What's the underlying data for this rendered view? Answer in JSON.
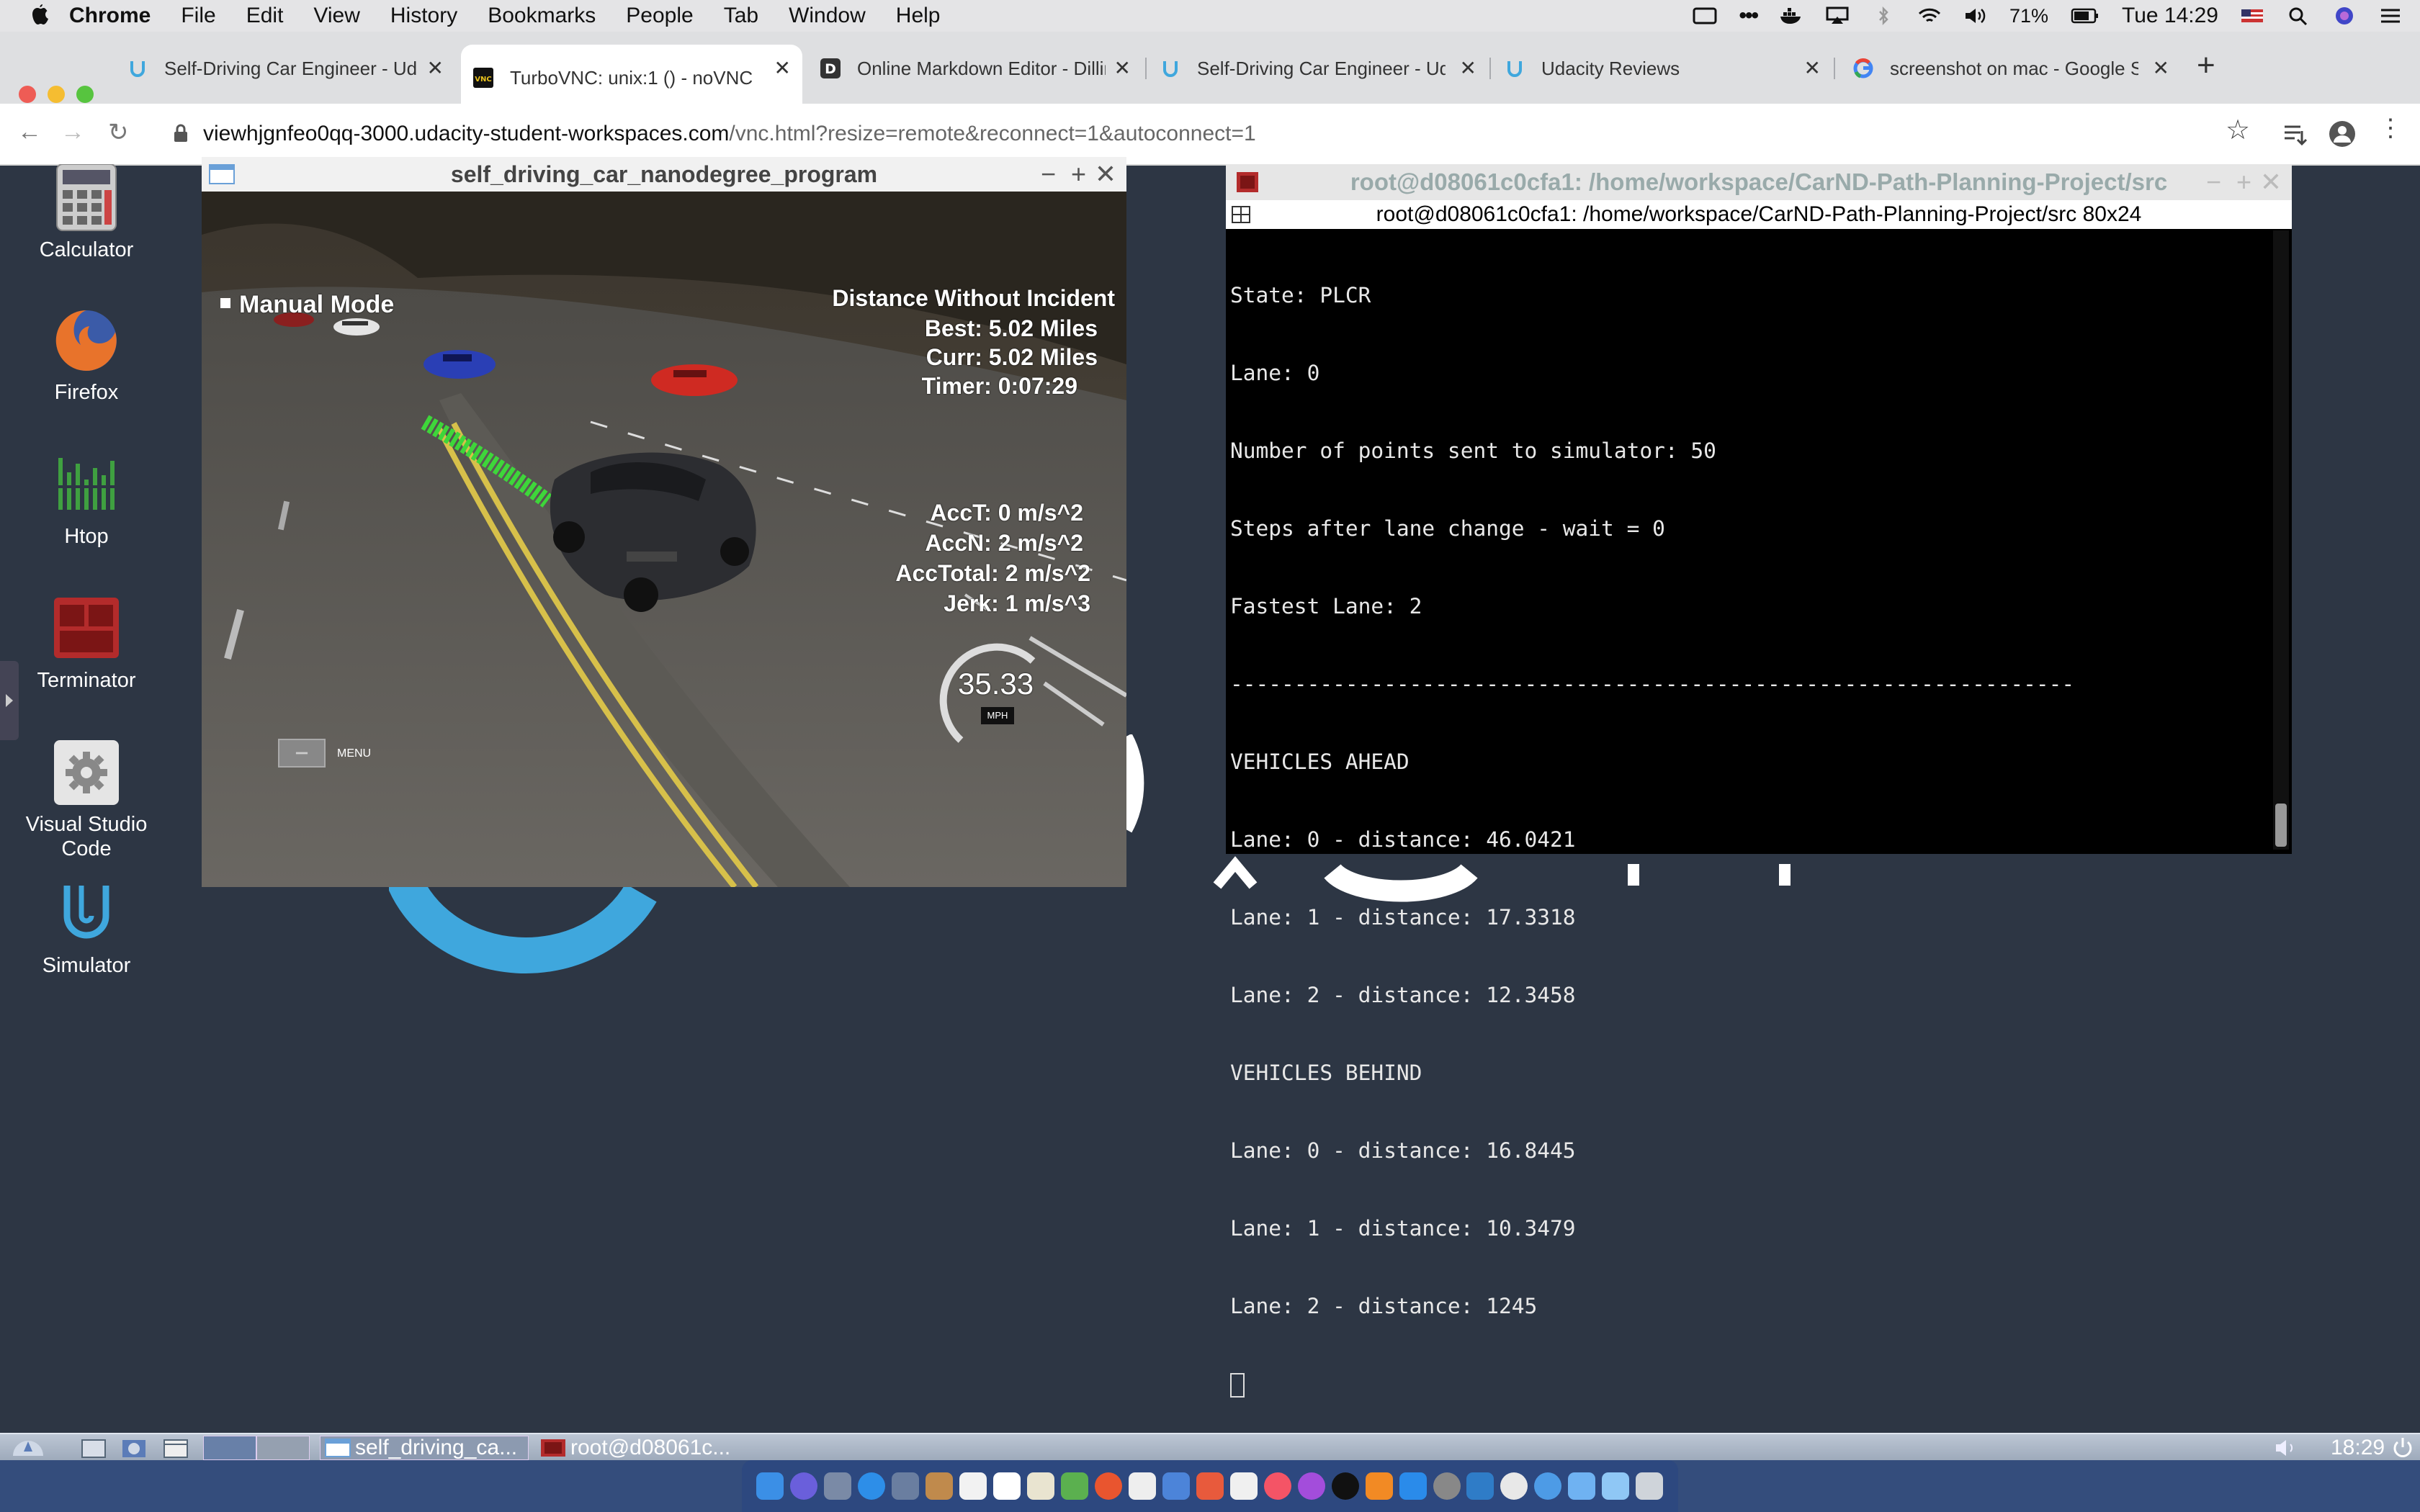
{
  "menubar": {
    "app": "Chrome",
    "items": [
      "File",
      "Edit",
      "View",
      "History",
      "Bookmarks",
      "People",
      "Tab",
      "Window",
      "Help"
    ],
    "battery": "71%",
    "clock": "Tue 14:29"
  },
  "tabs": [
    {
      "title": "Self-Driving Car Engineer - Ud",
      "icon": "udacity-icon"
    },
    {
      "title": "TurboVNC: unix:1 () - noVNC",
      "icon": "vnc-icon",
      "active": true
    },
    {
      "title": "Online Markdown Editor - Dillin",
      "icon": "dillinger-icon"
    },
    {
      "title": "Self-Driving Car Engineer - Ud",
      "icon": "udacity-icon"
    },
    {
      "title": "Udacity Reviews",
      "icon": "udacity-icon"
    },
    {
      "title": "screenshot on mac - Google Se",
      "icon": "google-icon"
    }
  ],
  "address": {
    "host": "viewhjgnfeo0qq-3000.udacity-student-workspaces.com",
    "path": "/vnc.html?resize=remote&reconnect=1&autoconnect=1"
  },
  "desktop_icons": [
    {
      "label": "Calculator"
    },
    {
      "label": "Firefox"
    },
    {
      "label": "Htop"
    },
    {
      "label": "Terminator"
    },
    {
      "label": "Visual Studio Code"
    },
    {
      "label": "Simulator"
    }
  ],
  "simulator": {
    "title": "self_driving_car_nanodegree_program",
    "mode": "Manual Mode",
    "distance_title": "Distance Without Incident",
    "best": "Best: 5.02 Miles",
    "curr": "Curr: 5.02 Miles",
    "timer": "Timer: 0:07:29",
    "acct": "AccT: 0 m/s^2",
    "accn": "AccN: 2 m/s^2",
    "acctotal": "AccTotal: 2 m/s^2",
    "jerk": "Jerk: 1 m/s^3",
    "speed": "35.33",
    "speed_unit": "MPH",
    "menu": "MENU"
  },
  "terminal": {
    "title": "root@d08061c0cfa1: /home/workspace/CarND-Path-Planning-Project/src",
    "subtitle": "root@d08061c0cfa1: /home/workspace/CarND-Path-Planning-Project/src 80x24",
    "lines": [
      "State: PLCR",
      "Lane: 0",
      "Number of points sent to simulator: 50",
      "Steps after lane change - wait = 0",
      "Fastest Lane: 2",
      "------------------------------------------------------------------",
      "VEHICLES AHEAD",
      "Lane: 0 - distance: 46.0421",
      "Lane: 1 - distance: 17.3318",
      "Lane: 2 - distance: 12.3458",
      "VEHICLES BEHIND",
      "Lane: 0 - distance: 16.8445",
      "Lane: 1 - distance: 10.3479",
      "Lane: 2 - distance: 1245"
    ]
  },
  "taskbar": {
    "task1": "self_driving_ca...",
    "task2": "root@d08061c...",
    "clock": "18:29"
  },
  "colors": {
    "desktop": "#2d3644",
    "udacity_blue": "#3fa7dd",
    "path_green": "#3ed63a"
  }
}
